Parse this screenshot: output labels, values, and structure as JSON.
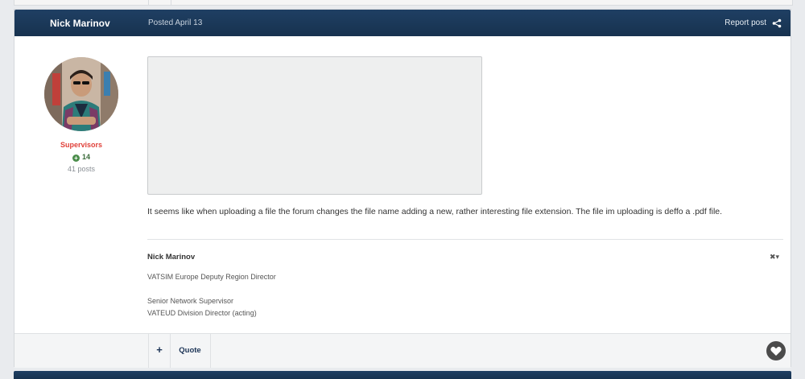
{
  "post": {
    "author": "Nick Marinov",
    "posted": "Posted April 13",
    "report_label": "Report post",
    "group": "Supervisors",
    "reputation": "14",
    "post_count": "41 posts",
    "body": "It seems like when uploading a file the forum changes the file name adding a new, rather interesting file extension. The file im uploading is deffo a .pdf file.",
    "signature": {
      "name": "Nick Marinov",
      "toggle": "✖▾",
      "lines": [
        "VATSIM Europe Deputy Region Director",
        "Senior Network Supervisor",
        "VATEUD Division Director (acting)"
      ]
    },
    "controls": {
      "plus_label": "+",
      "quote_label": "Quote"
    }
  },
  "colors": {
    "header_bg": "#1a3656",
    "group_color": "#e0413a",
    "reputation_color": "#3a6b3a"
  }
}
